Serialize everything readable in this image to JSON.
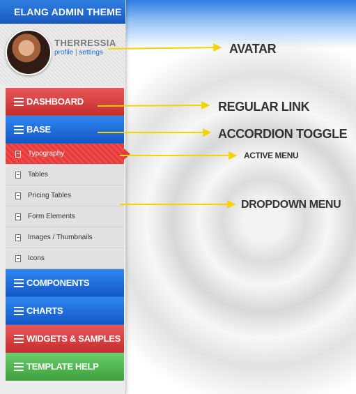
{
  "brand": {
    "title": "ELANG ADMIN THEME"
  },
  "profile": {
    "name": "THERRESSIA",
    "links": {
      "profile": "profile",
      "separator": "|",
      "settings": "settings"
    }
  },
  "menu": {
    "items": [
      {
        "label": "DASHBOARD",
        "color": "red"
      },
      {
        "label": "BASE",
        "color": "blue"
      },
      {
        "label": "COMPONENTS",
        "color": "blue"
      },
      {
        "label": "CHARTS",
        "color": "blue"
      },
      {
        "label": "WIDGETS & SAMPLES",
        "color": "red"
      },
      {
        "label": "TEMPLATE HELP",
        "color": "green"
      }
    ],
    "submenu": [
      {
        "label": "Typography",
        "active": true
      },
      {
        "label": "Tables"
      },
      {
        "label": "Pricing Tables"
      },
      {
        "label": "Form Elements"
      },
      {
        "label": "Images / Thumbnails"
      },
      {
        "label": "Icons"
      }
    ]
  },
  "annotations": {
    "avatar": "AVATAR",
    "regular_link": "REGULAR LINK",
    "accordion_toggle": "ACCORDION TOGGLE",
    "active_menu": "ACTIVE MENU",
    "dropdown_menu": "DROPDOWN MENU"
  },
  "colors": {
    "brand_blue": "#1f6fd6",
    "menu_red": "#d83b3b",
    "menu_blue": "#1c68dc",
    "menu_green": "#4fb84f",
    "arrow_yellow": "#f3d400"
  }
}
